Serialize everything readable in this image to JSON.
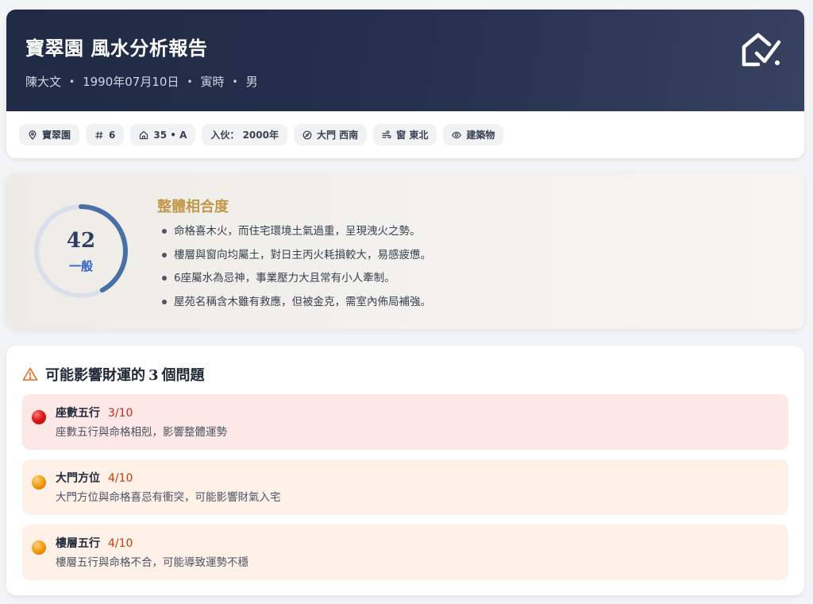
{
  "header": {
    "title": "寶翠園 風水分析報告",
    "subtitle": {
      "name": "陳大文",
      "dob": "1990年07月10日",
      "hour": "寅時",
      "gender": "男"
    },
    "separator": "•",
    "logo_icon": "house-check-icon",
    "chips": [
      {
        "icon": "location-pin-icon",
        "label": "寶翠園"
      },
      {
        "icon": "hash-icon",
        "label": "6"
      },
      {
        "icon": "home-icon",
        "label": "35 • A"
      },
      {
        "icon": "",
        "label": "入伙： 2000年"
      },
      {
        "icon": "compass-icon",
        "label": "大門 西南"
      },
      {
        "icon": "wind-icon",
        "label": "窗 東北"
      },
      {
        "icon": "eye-icon",
        "label": "建築物"
      }
    ]
  },
  "overall": {
    "score": "42",
    "score_fraction": 0.42,
    "level": "一般",
    "title": "整體相合度",
    "points": [
      "命格喜木火，而住宅環境土氣過重，呈現洩火之勢。",
      "樓層與窗向均屬土，對日主丙火耗損較大，易感疲憊。",
      "6座屬水為忌神，事業壓力大且常有小人牽制。",
      "屋苑名稱含木雖有救應，但被金克，需室內佈局補強。"
    ],
    "colors": {
      "gauge": "#4a6fa5",
      "track": "#d9e0ec",
      "title": "#c2974a"
    }
  },
  "issues": {
    "title_prefix": "可能影響財運的",
    "count": "3",
    "title_suffix": "個問題",
    "icon": "warning-triangle-icon",
    "items": [
      {
        "level": "red",
        "name": "座數五行",
        "score": "3/10",
        "desc": "座數五行與命格相剋，影響整體運勢"
      },
      {
        "level": "orange",
        "name": "大門方位",
        "score": "4/10",
        "desc": "大門方位與命格喜忌有衝突，可能影響財氣入宅"
      },
      {
        "level": "orange",
        "name": "樓層五行",
        "score": "4/10",
        "desc": "樓層五行與命格不合，可能導致運勢不穩"
      }
    ]
  }
}
